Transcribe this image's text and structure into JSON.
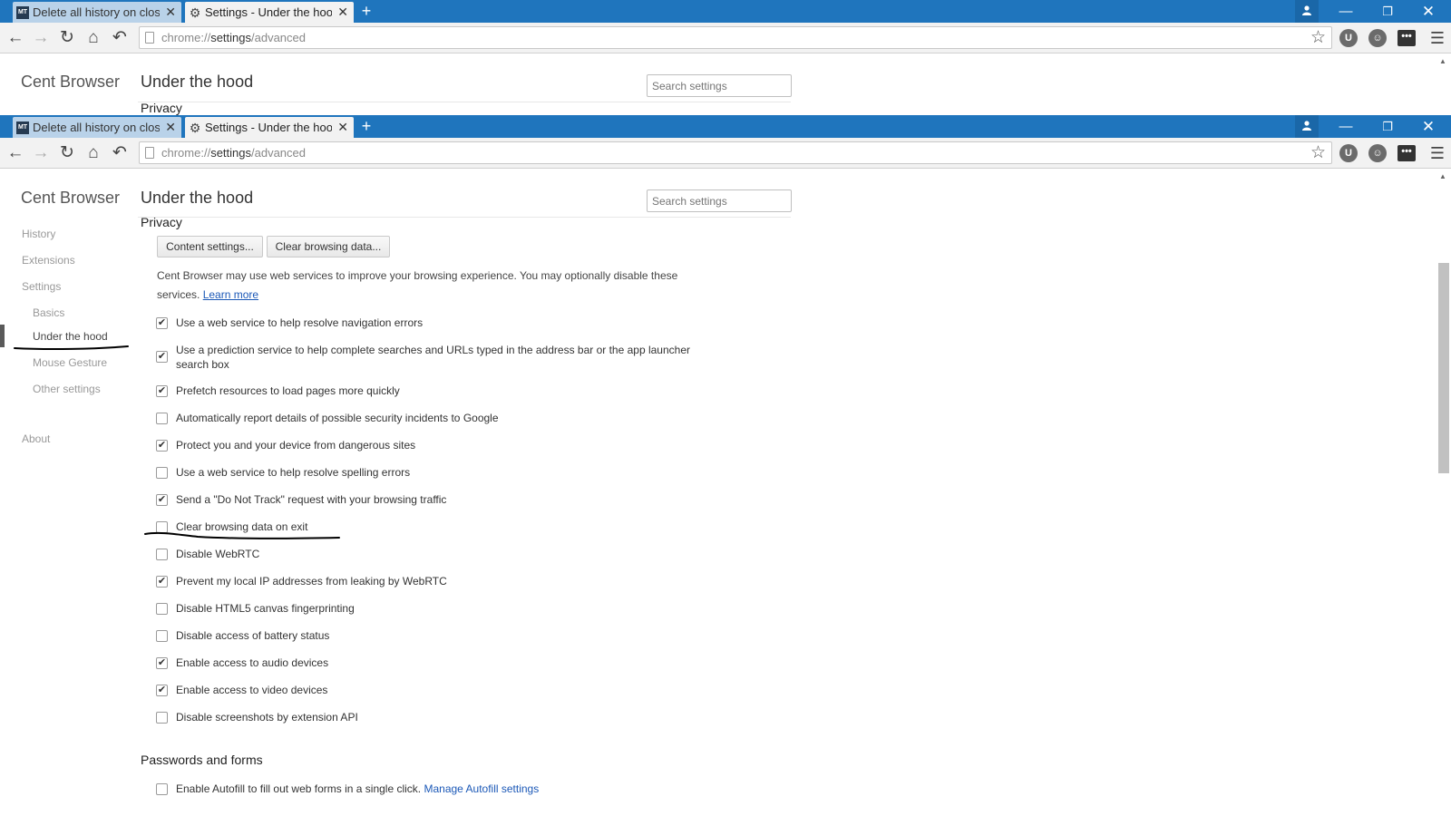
{
  "tabs": [
    {
      "title": "Delete all history on close",
      "favicon": "mt-favicon-icon"
    },
    {
      "title": "Settings - Under the hood",
      "favicon": "gear-icon"
    }
  ],
  "tab_close_glyph": "✕",
  "new_tab_glyph": "+",
  "window_controls": {
    "minimize": "—",
    "maximize": "❐",
    "close": "✕"
  },
  "omnibox": {
    "scheme": "chrome://",
    "host": "settings",
    "path": "/advanced"
  },
  "extensions": {
    "u": "U",
    "ghost": "👻",
    "menu": "•••"
  },
  "brand": "Cent Browser",
  "page_title": "Under the hood",
  "search": {
    "placeholder": "Search settings"
  },
  "sidebar": {
    "history": "History",
    "extensions": "Extensions",
    "settings": "Settings",
    "basics": "Basics",
    "under_the_hood": "Under the hood",
    "mouse_gesture": "Mouse Gesture",
    "other_settings": "Other settings",
    "about": "About"
  },
  "privacy": {
    "heading": "Privacy",
    "content_settings_btn": "Content settings...",
    "clear_browsing_btn": "Clear browsing data...",
    "description": "Cent Browser may use web services to improve your browsing experience. You may optionally disable these",
    "description_2": "services.",
    "learn_more": "Learn more",
    "options": [
      {
        "label": "Use a web service to help resolve navigation errors",
        "checked": true
      },
      {
        "label": "Use a prediction service to help complete searches and URLs typed in the address bar or the app launcher search box",
        "checked": true
      },
      {
        "label": "Prefetch resources to load pages more quickly",
        "checked": true
      },
      {
        "label": "Automatically report details of possible security incidents to Google",
        "checked": false
      },
      {
        "label": "Protect you and your device from dangerous sites",
        "checked": true
      },
      {
        "label": "Use a web service to help resolve spelling errors",
        "checked": false
      },
      {
        "label": "Send a \"Do Not Track\" request with your browsing traffic",
        "checked": true
      },
      {
        "label": "Clear browsing data on exit",
        "checked": false
      },
      {
        "label": "Disable WebRTC",
        "checked": false
      },
      {
        "label": "Prevent my local IP addresses from leaking by WebRTC",
        "checked": true
      },
      {
        "label": "Disable HTML5 canvas fingerprinting",
        "checked": false
      },
      {
        "label": "Disable access of battery status",
        "checked": false
      },
      {
        "label": "Enable access to audio devices",
        "checked": true
      },
      {
        "label": "Enable access to video devices",
        "checked": true
      },
      {
        "label": "Disable screenshots by extension API",
        "checked": false
      }
    ]
  },
  "passwords": {
    "heading": "Passwords and forms",
    "autofill_label": "Enable Autofill to fill out web forms in a single click.",
    "autofill_link": "Manage Autofill settings",
    "autofill_checked": false
  },
  "checkmark_glyph": "✔",
  "colors": {
    "titlebar": "#1f75bd",
    "link": "#1b58b7",
    "annotation": "#000000"
  }
}
